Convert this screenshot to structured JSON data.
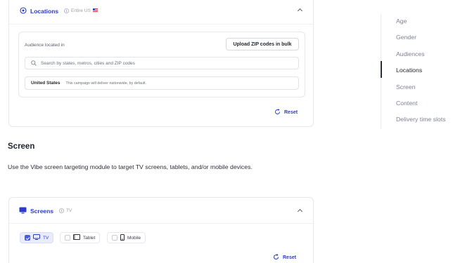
{
  "locations": {
    "title": "Locations",
    "subtitle": "Entire US",
    "flag_icon": "us-flag-icon",
    "audience_label": "Audience located in",
    "upload_button": "Upload ZIP codes in bulk",
    "search": {
      "placeholder": "Search by states, metros, cities and ZIP codes"
    },
    "selected_row": {
      "name": "United States",
      "note": "This campaign will deliver nationwide, by default."
    },
    "reset_label": "Reset"
  },
  "screen_section": {
    "title": "Screen",
    "description": "Use the Vibe screen targeting module to target TV screens, tablets, and/or mobile devices."
  },
  "screens": {
    "title": "Screens",
    "subtitle": "TV",
    "options": [
      {
        "label": "TV",
        "checked": true
      },
      {
        "label": "Tablet",
        "checked": false
      },
      {
        "label": "Mobile",
        "checked": false
      }
    ],
    "reset_label": "Reset"
  },
  "nav": {
    "items": [
      {
        "label": "Age"
      },
      {
        "label": "Gender"
      },
      {
        "label": "Audiences"
      },
      {
        "label": "Locations"
      },
      {
        "label": "Screen"
      },
      {
        "label": "Content"
      },
      {
        "label": "Delivery time slots"
      }
    ],
    "active": "Locations"
  },
  "colors": {
    "accent": "#2b3cc7",
    "checkbox": "#4b5bdb",
    "text": "#1f2430",
    "muted": "#7d8392"
  }
}
